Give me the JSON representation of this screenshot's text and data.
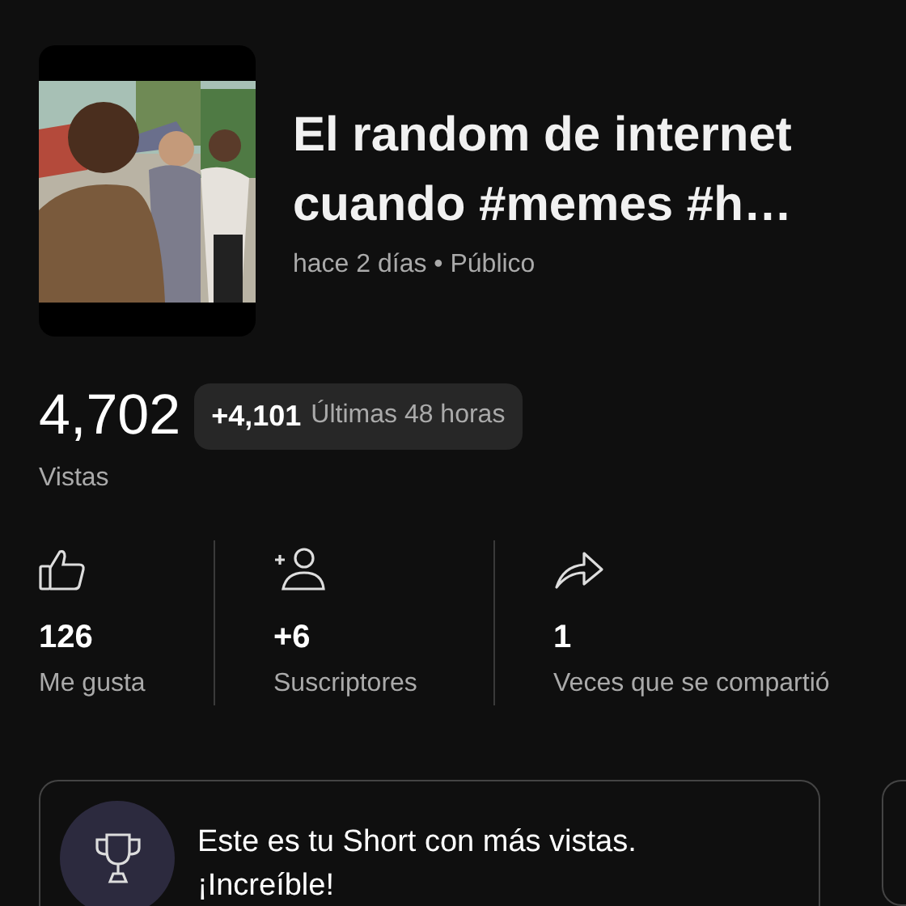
{
  "video": {
    "title": "El random de internet cuando #memes #h…",
    "meta": "hace 2 días • Público"
  },
  "views": {
    "count": "4,702",
    "delta": "+4,101",
    "period": "Últimas 48 horas",
    "label": "Vistas"
  },
  "stats": [
    {
      "kind": "likes",
      "value": "126",
      "label": "Me gusta"
    },
    {
      "kind": "subscribers",
      "value": "+6",
      "label": "Suscriptores"
    },
    {
      "kind": "shares",
      "value": "1",
      "label": "Veces que se compartió"
    }
  ],
  "cards": [
    {
      "kind": "trophy",
      "text": "Este es tu Short con más vistas. ¡Increíble!"
    }
  ]
}
